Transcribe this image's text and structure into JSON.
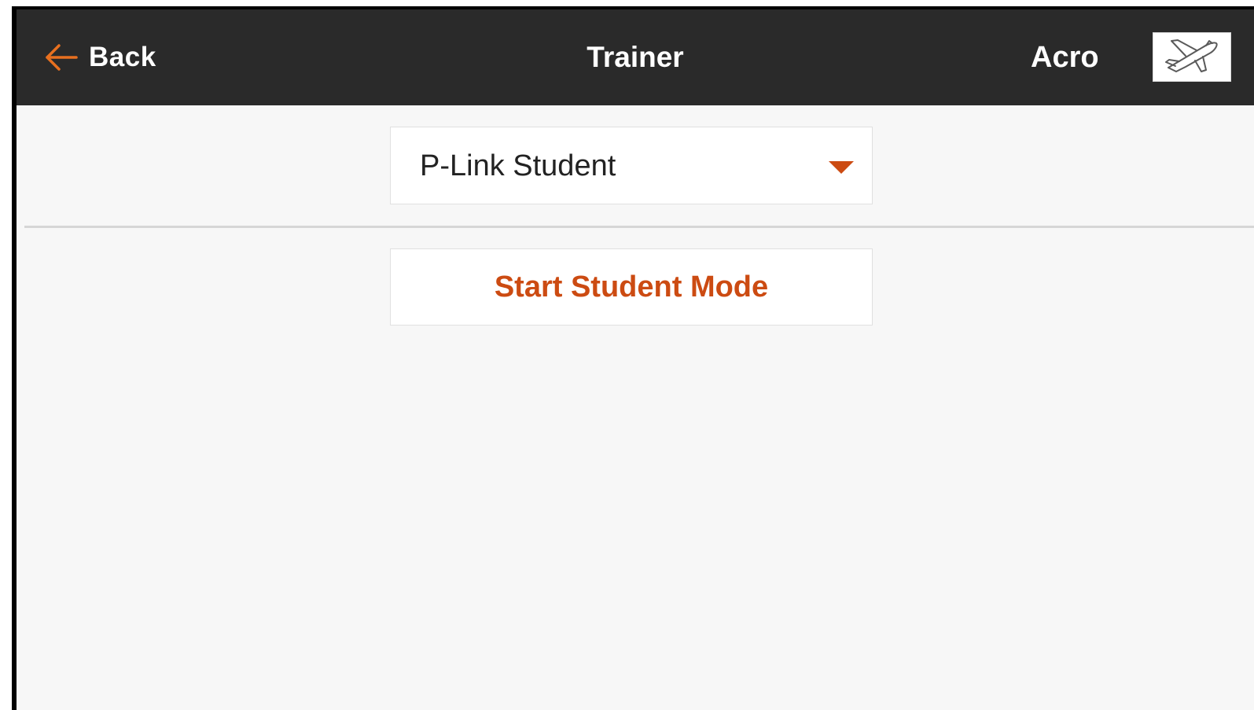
{
  "header": {
    "back_label": "Back",
    "title": "Trainer",
    "mode": "Acro",
    "model_icon": "airplane-icon",
    "back_icon": "arrow-left-icon"
  },
  "trainer": {
    "selected_mode": "P-Link Student",
    "dropdown_icon": "caret-down-icon",
    "action_label": "Start Student Mode"
  },
  "colors": {
    "accent": "#cc4b12",
    "topbar": "#2a2a2a",
    "background": "#f7f7f7"
  }
}
